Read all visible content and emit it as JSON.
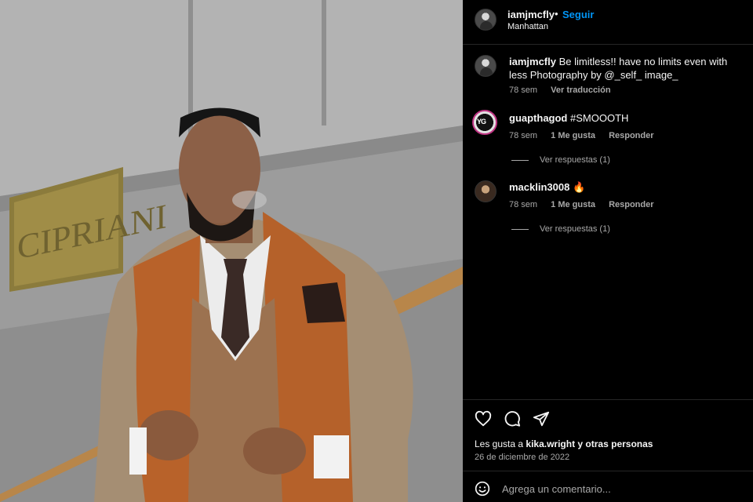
{
  "photo": {
    "sign_text": "CIPRIANI",
    "alt_subject": "man in leather vest and tweed jacket smoking"
  },
  "header": {
    "username": "iamjmcfly",
    "dot": "•",
    "follow_label": "Seguir",
    "location": "Manhattan"
  },
  "caption": {
    "username": "iamjmcfly",
    "text": "Be limitless!! have no limits even with less Photography by @_self_ image_",
    "time": "78 sem",
    "translate": "Ver traducción"
  },
  "comments": [
    {
      "username": "guapthagod",
      "text": "#SMOOOTH",
      "time": "78 sem",
      "likes": "1 Me gusta",
      "reply": "Responder",
      "view_replies": "Ver respuestas (1)",
      "avatar_text": "YG"
    },
    {
      "username": "macklin3008",
      "text": "🔥",
      "time": "78 sem",
      "likes": "1 Me gusta",
      "reply": "Responder",
      "view_replies": "Ver respuestas (1)"
    }
  ],
  "actions": {
    "icons": [
      "heart-icon",
      "comment-icon",
      "share-icon"
    ],
    "likes_prefix": "Les gusta a",
    "likes_user": "kika.wright",
    "likes_suffix": "y otras personas",
    "date": "26 de diciembre de 2022"
  },
  "add_comment": {
    "placeholder": "Agrega un comentario..."
  },
  "colors": {
    "background": "#000000",
    "accent": "#0095f6",
    "secondary_text": "#a8a8a8",
    "divider": "#262626"
  }
}
